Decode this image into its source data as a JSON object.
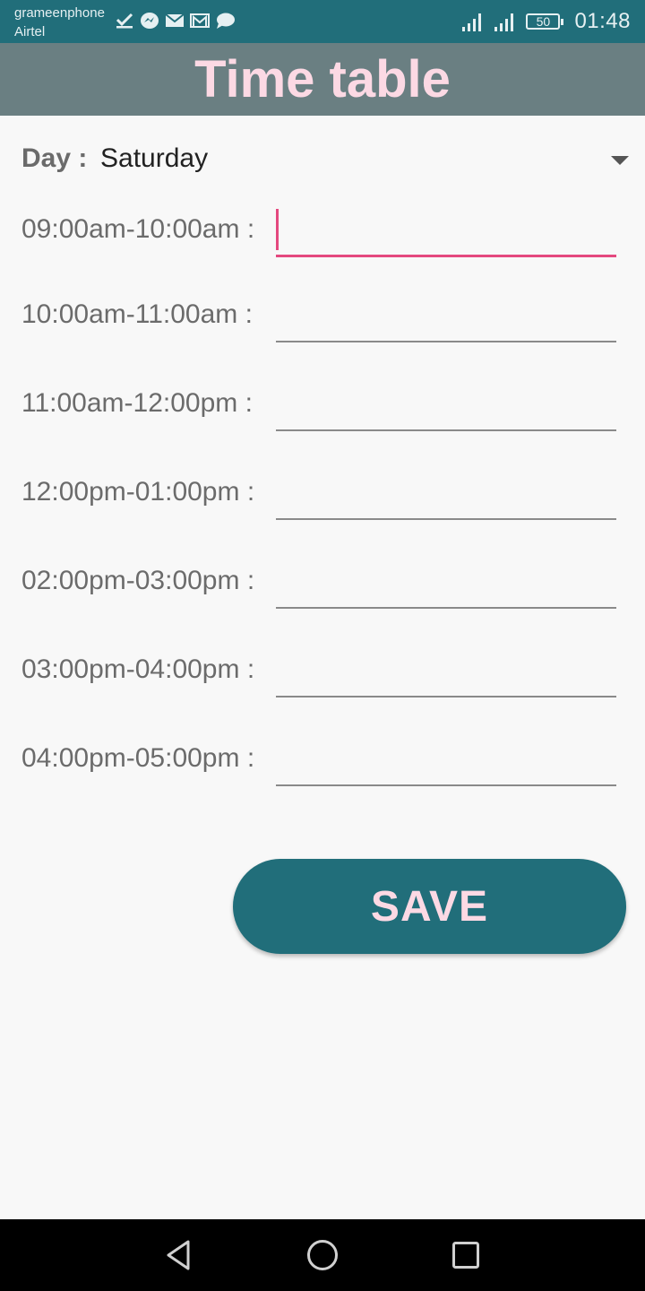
{
  "status_bar": {
    "carrier_1": "grameenphone",
    "carrier_2": "Airtel",
    "notification_icons": [
      "check-icon",
      "messenger-icon",
      "mail-icon",
      "gmail-icon",
      "chat-icon"
    ],
    "battery_level": "50",
    "time": "01:48"
  },
  "header": {
    "title": "Time table"
  },
  "day": {
    "label": "Day :",
    "value": "Saturday"
  },
  "slots": [
    {
      "label": "09:00am-10:00am :",
      "value": ""
    },
    {
      "label": "10:00am-11:00am :",
      "value": ""
    },
    {
      "label": "11:00am-12:00pm :",
      "value": ""
    },
    {
      "label": "12:00pm-01:00pm :",
      "value": ""
    },
    {
      "label": "02:00pm-03:00pm :",
      "value": ""
    },
    {
      "label": "03:00pm-04:00pm :",
      "value": ""
    },
    {
      "label": "04:00pm-05:00pm :",
      "value": ""
    }
  ],
  "save_button": {
    "label": "SAVE"
  },
  "colors": {
    "status_bar": "#216e7a",
    "title_bar": "#6a7f82",
    "title_text": "#fcd9e4",
    "accent": "#e4497f",
    "button": "#216e7a"
  }
}
